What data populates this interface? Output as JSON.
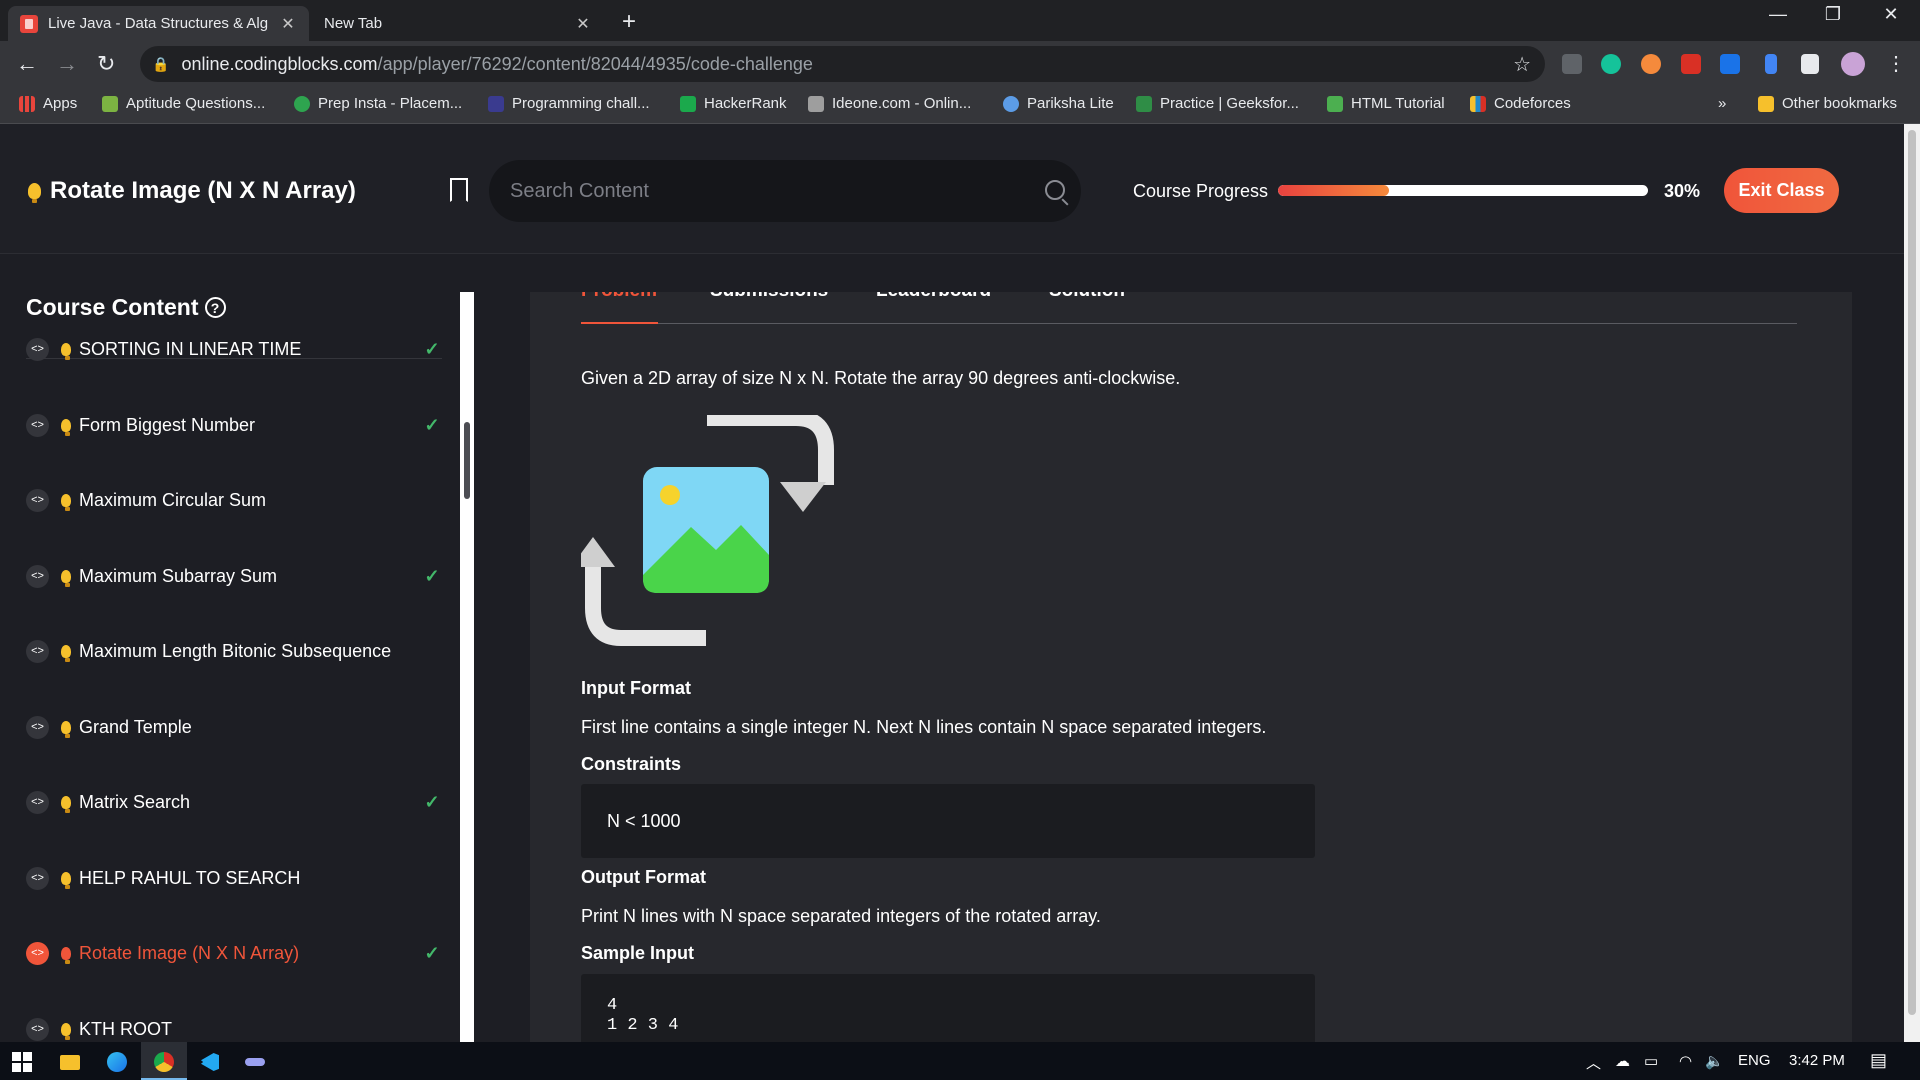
{
  "browser": {
    "tabs": [
      {
        "title": "Live Java - Data Structures & Alg"
      },
      {
        "title": "New Tab"
      }
    ],
    "url_host": "online.codingblocks.com",
    "url_path": "/app/player/76292/content/82044/4935/code-challenge",
    "bookmarks": [
      {
        "label": "Apps",
        "color": "#e8453c"
      },
      {
        "label": "Aptitude Questions...",
        "color": "#7cb342"
      },
      {
        "label": "Prep Insta - Placem...",
        "color": "#2ea44f"
      },
      {
        "label": "Programming chall...",
        "color": "#3a3b8f"
      },
      {
        "label": "HackerRank",
        "color": "#1ba94c"
      },
      {
        "label": "Ideone.com - Onlin...",
        "color": "#9e9e9e"
      },
      {
        "label": "Pariksha Lite",
        "color": "#5c9ce6"
      },
      {
        "label": "Practice | Geeksfor...",
        "color": "#2f8d46"
      },
      {
        "label": "HTML Tutorial",
        "color": "#4caf50"
      },
      {
        "label": "Codeforces",
        "color": "#1f8acb"
      },
      {
        "label": "Other bookmarks",
        "color": "#f6c02c"
      }
    ],
    "more_bookmarks": "»"
  },
  "header": {
    "title": "Rotate Image (N X N Array)",
    "search_placeholder": "Search Content",
    "progress_label": "Course Progress",
    "progress_pct": "30%",
    "progress_fraction": 0.3,
    "exit_label": "Exit Class",
    "accent": "#f0553a"
  },
  "sidebar": {
    "heading": "Course Content",
    "help": "?",
    "items": [
      {
        "label": "SORTING IN LINEAR TIME",
        "done": true,
        "active": false
      },
      {
        "label": "Form Biggest Number",
        "done": true,
        "active": false
      },
      {
        "label": "Maximum Circular Sum",
        "done": false,
        "active": false
      },
      {
        "label": "Maximum Subarray Sum",
        "done": true,
        "active": false
      },
      {
        "label": "Maximum Length Bitonic Subsequence",
        "done": false,
        "active": false
      },
      {
        "label": "Grand Temple",
        "done": false,
        "active": false
      },
      {
        "label": "Matrix Search",
        "done": true,
        "active": false
      },
      {
        "label": "HELP RAHUL TO SEARCH",
        "done": false,
        "active": false
      },
      {
        "label": "Rotate Image (N X N Array)",
        "done": true,
        "active": true
      },
      {
        "label": "KTH ROOT",
        "done": false,
        "active": false
      }
    ]
  },
  "problem": {
    "tabs": [
      "Problem",
      "Submissions",
      "Leaderboard",
      "Solution"
    ],
    "statement": "Given a 2D array of size N x N. Rotate the array 90 degrees anti-clockwise.",
    "input_format_heading": "Input Format",
    "input_format": "First line contains a single integer N. Next N lines contain N space separated integers.",
    "constraints_heading": "Constraints",
    "constraints": "N < 1000",
    "output_format_heading": "Output Format",
    "output_format": "Print N lines with N space separated integers of the rotated array.",
    "sample_input_heading": "Sample Input",
    "sample_input_lines": [
      "4",
      "1 2 3 4"
    ]
  },
  "taskbar": {
    "lang": "ENG",
    "time": "3:42 PM"
  }
}
